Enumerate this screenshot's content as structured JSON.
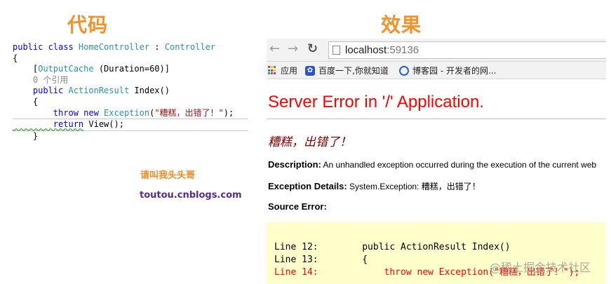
{
  "headings": {
    "left": "代码",
    "right": "效果"
  },
  "code_lines": {
    "l1_kw": "public class ",
    "l1_ty": "HomeController",
    "l1_sep": " : ",
    "l1_ty2": "Controller",
    "l2": "{",
    "l3_pre": "    [",
    "l3_ty": "OutputCache",
    "l3_post": " (Duration=60)]",
    "l4": "    0 个引用",
    "l5_kw": "    public ",
    "l5_ty": "ActionResult",
    "l5_post": " Index()",
    "l6": "    {",
    "l7_kw": "        throw new ",
    "l7_ty": "Exception",
    "l7_p1": "(",
    "l7_str": "\"糟糕，出错了！\"",
    "l7_p2": ");",
    "l8_kw": "        return",
    "l8_post": " View();",
    "l9": "    }"
  },
  "watermark": {
    "name": "请叫我头头哥",
    "site": "toutou.cnblogs.com"
  },
  "browser": {
    "url_host": "localhost",
    "url_port": ":59136",
    "bookmarks": [
      "应用",
      "百度一下,你就知道",
      "博客园 - 开发者的网..."
    ]
  },
  "error_page": {
    "title": "Server Error in '/' Application.",
    "message": "糟糕，出错了！",
    "description_label": "Description:",
    "description_text": " An unhandled exception occurred during the execution of the current web",
    "exception_label": "Exception Details:",
    "exception_text": " System.Exception: 糟糕，出错了！",
    "source_label": "Source Error:",
    "source_lines": [
      "Line 12:        public ActionResult Index()",
      "Line 13:        {",
      "Line 14:            throw new Exception(\"糟糕，出错了！\");"
    ]
  },
  "corner_watermark": "@稀土掘金技术社区",
  "colors": {
    "accent_orange": "#f2922b",
    "error_red": "#ff0000",
    "message_maroon": "#800000",
    "source_bg": "#ffffcc"
  }
}
